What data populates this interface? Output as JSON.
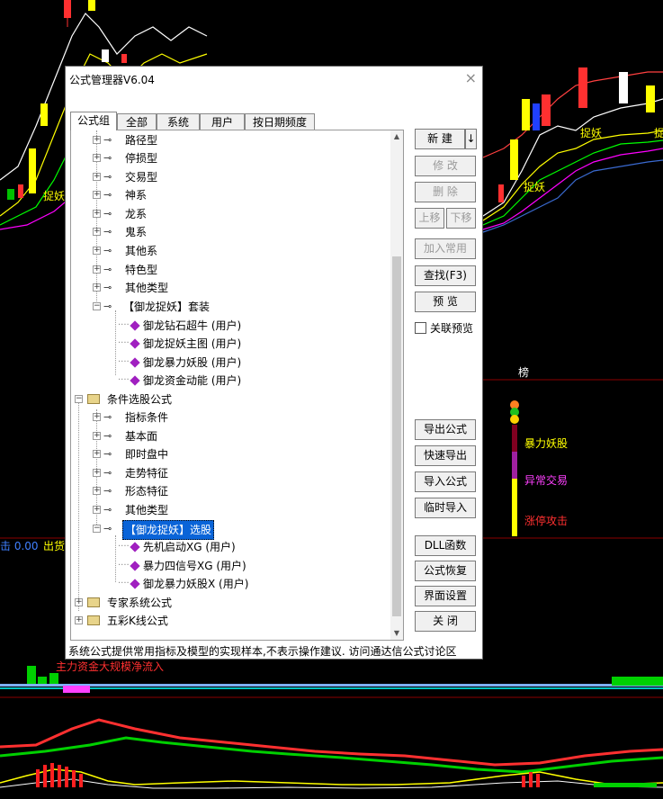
{
  "background": {
    "labels": {
      "zhuoyao_left": "捉妖",
      "zhuoyao_right1": "捉妖",
      "zhuoyao_right2": "捉妖",
      "zhuoyao_far": "捉",
      "bang": "榜",
      "baoli": "暴力妖股",
      "yichang": "异常交易",
      "zhangting": "涨停攻击",
      "left_readout": "击 0.00",
      "left_readout2": "出货",
      "zhuli": "主力资金大规模净流入"
    }
  },
  "dialog": {
    "title": "公式管理器V6.04",
    "close": "×",
    "tabs": [
      "公式组",
      "全部",
      "系统",
      "用户",
      "按日期频度"
    ],
    "tree": [
      {
        "label": "路径型"
      },
      {
        "label": "停损型"
      },
      {
        "label": "交易型"
      },
      {
        "label": "神系"
      },
      {
        "label": "龙系"
      },
      {
        "label": "鬼系"
      },
      {
        "label": "其他系"
      },
      {
        "label": "特色型"
      },
      {
        "label": "其他类型"
      },
      {
        "label": "【御龙捉妖】套装"
      },
      {
        "label": "御龙钻石超牛  (用户)"
      },
      {
        "label": "御龙捉妖主图  (用户)"
      },
      {
        "label": "御龙暴力妖股  (用户)"
      },
      {
        "label": "御龙资金动能  (用户)"
      },
      {
        "label": "条件选股公式"
      },
      {
        "label": "指标条件"
      },
      {
        "label": "基本面"
      },
      {
        "label": "即时盘中"
      },
      {
        "label": "走势特征"
      },
      {
        "label": "形态特征"
      },
      {
        "label": "其他类型"
      },
      {
        "label": "【御龙捉妖】选股"
      },
      {
        "label": "先机启动XG  (用户)"
      },
      {
        "label": "暴力四信号XG  (用户)"
      },
      {
        "label": "御龙暴力妖股X  (用户)"
      },
      {
        "label": "专家系统公式"
      },
      {
        "label": "五彩K线公式"
      }
    ],
    "buttons": {
      "new": "新 建",
      "new_arrow": "↓",
      "modify": "修 改",
      "delete": "删 除",
      "move_up": "上移",
      "move_down": "下移",
      "add_common": "加入常用",
      "find": "查找(F3)",
      "preview": "预 览",
      "assoc_preview": "关联预览",
      "export": "导出公式",
      "quick_export": "快速导出",
      "import": "导入公式",
      "temp_import": "临时导入",
      "dll": "DLL函数",
      "restore": "公式恢复",
      "ui_settings": "界面设置",
      "close": "关 闭"
    },
    "status": "系统公式提供常用指标及模型的实现样本,不表示操作建议.   访问通达信公式讨论区"
  }
}
